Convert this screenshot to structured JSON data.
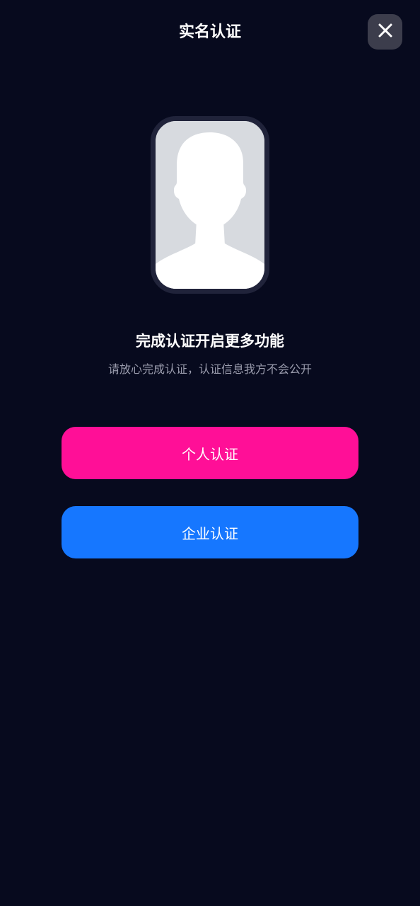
{
  "header": {
    "title": "实名认证",
    "close_icon": "close-icon"
  },
  "avatar": {
    "icon": "person-silhouette-icon"
  },
  "content": {
    "headline": "完成认证开启更多功能",
    "subtext": "请放心完成认证，认证信息我方不会公开"
  },
  "actions": {
    "personal_label": "个人认证",
    "enterprise_label": "企业认证"
  },
  "colors": {
    "background": "#070a1e",
    "personal_button": "#ff0f97",
    "enterprise_button": "#1677ff",
    "subtext": "#9a9cad"
  }
}
